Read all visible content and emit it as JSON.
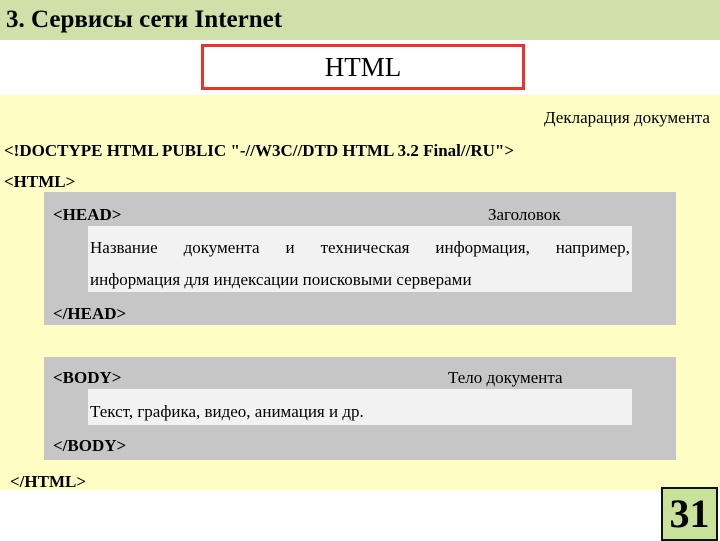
{
  "slide": {
    "title": "3. Сервисы сети Internet",
    "header_box": "HTML",
    "page_number": "31"
  },
  "document": {
    "declaration_label": "Декларация документа",
    "doctype": "<!DOCTYPE HTML PUBLIC \"-//W3C//DTD HTML 3.2 Final//RU\">",
    "html_open": "<HTML>",
    "html_close": "</HTML>",
    "head": {
      "open": "<HEAD>",
      "label": "Заголовок",
      "description_words": [
        "Название",
        "документа",
        "и",
        "техническая",
        "информация,",
        "например,"
      ],
      "description_line2": "информация для индексации поисковыми серверами",
      "close": "</HEAD>"
    },
    "body": {
      "open": "<BODY>",
      "label": "Тело документа",
      "description": "Текст, графика, видео, анимация и др.",
      "close": "</BODY>"
    }
  }
}
